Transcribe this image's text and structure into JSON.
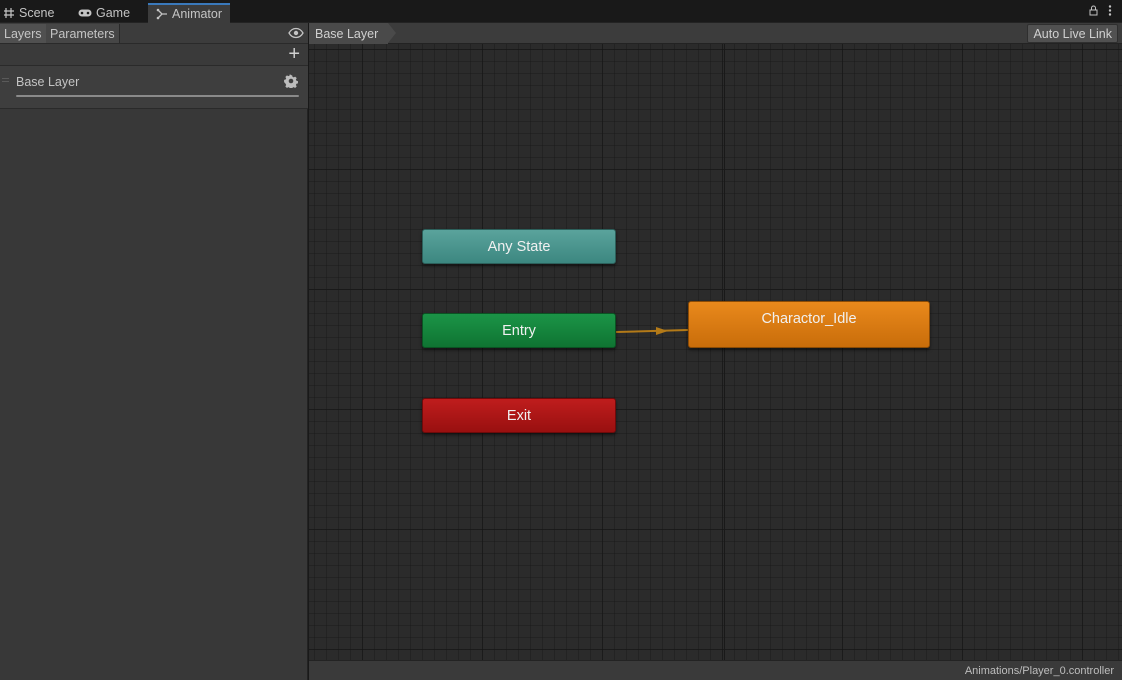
{
  "tabs": [
    {
      "label": "Scene",
      "icon": "grid-icon"
    },
    {
      "label": "Game",
      "icon": "gamepad-icon"
    },
    {
      "label": "Animator",
      "icon": "animator-icon",
      "active": true
    }
  ],
  "left_panel": {
    "toolbar": {
      "layers_label": "Layers",
      "parameters_label": "Parameters"
    },
    "layers": [
      {
        "name": "Base Layer"
      }
    ]
  },
  "graph": {
    "breadcrumb": "Base Layer",
    "auto_live_link_label": "Auto Live Link",
    "states": {
      "any_state": "Any State",
      "entry": "Entry",
      "exit": "Exit",
      "idle": "Charactor_Idle"
    },
    "controller_path": "Animations/Player_0.controller"
  },
  "colors": {
    "accent_tab": "#3a79bb",
    "any_state": "#4a958e",
    "entry": "#168541",
    "exit": "#ab1616",
    "default_state": "#e07e12",
    "transition": "#b37a18"
  }
}
